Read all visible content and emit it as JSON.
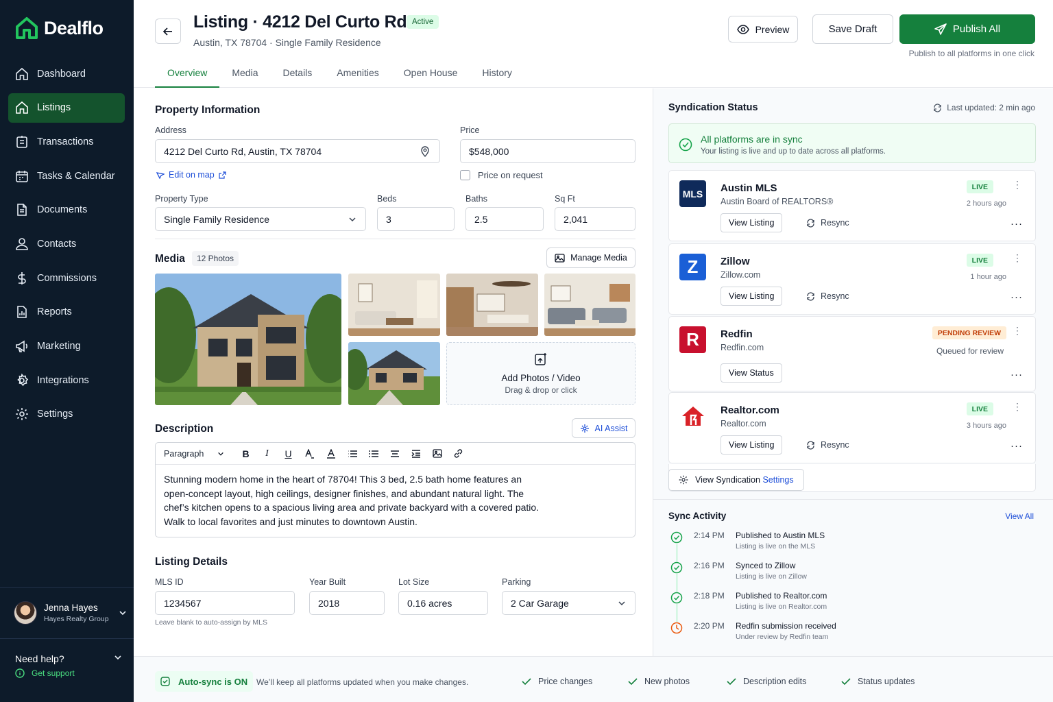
{
  "brand": {
    "name": "Dealflo",
    "accent": "#15803d",
    "sidebar_bg": "#0d1b2a"
  },
  "sidebar": {
    "items": [
      {
        "label": "Dashboard",
        "icon": "home-icon"
      },
      {
        "label": "Listings",
        "icon": "home-icon",
        "active": true
      },
      {
        "label": "Transactions",
        "icon": "document-icon"
      },
      {
        "label": "Tasks & Calendar",
        "icon": "calendar-icon"
      },
      {
        "label": "Documents",
        "icon": "file-icon"
      },
      {
        "label": "Contacts",
        "icon": "user-icon"
      },
      {
        "label": "Commissions",
        "icon": "dollar-icon"
      },
      {
        "label": "Reports",
        "icon": "report-icon"
      },
      {
        "label": "Marketing",
        "icon": "megaphone-icon"
      },
      {
        "label": "Integrations",
        "icon": "integrations-icon"
      },
      {
        "label": "Settings",
        "icon": "gear-icon"
      }
    ],
    "user": {
      "name": "Jenna Hayes",
      "org": "Hayes Realty Group"
    },
    "help": {
      "title": "Need help?",
      "link": "Get support"
    }
  },
  "header": {
    "title": "Listing · 4212 Del Curto Rd",
    "status": "Active",
    "subtitle": "Austin, TX 78704 · Single Family Residence",
    "preview": "Preview",
    "save": "Save Draft",
    "publish": "Publish All",
    "publish_hint": "Publish to all platforms in one click",
    "tabs": [
      "Overview",
      "Media",
      "Details",
      "Amenities",
      "Open House",
      "History"
    ]
  },
  "property": {
    "title": "Property Information",
    "address_label": "Address",
    "address": "4212 Del Curto Rd, Austin, TX 78704",
    "edit_map": "Edit on map",
    "price_label": "Price",
    "price": "$548,000",
    "price_on_request": "Price on request",
    "type_label": "Property Type",
    "type": "Single Family Residence",
    "beds_label": "Beds",
    "beds": "3",
    "baths_label": "Baths",
    "baths": "2.5",
    "sqft_label": "Sq Ft",
    "sqft": "2,041"
  },
  "media": {
    "title": "Media",
    "count": "12 Photos",
    "manage": "Manage Media",
    "add_title": "Add Photos / Video",
    "add_sub": "Drag & drop or click"
  },
  "description": {
    "title": "Description",
    "ai": "AI Assist",
    "format": "Paragraph",
    "lines": [
      "Stunning modern home in the heart of 78704! This 3 bed, 2.5 bath home features an",
      "open-concept layout, high ceilings, designer finishes, and abundant natural light. The",
      "chef’s kitchen opens to a spacious living area and private backyard with a covered patio.",
      "Walk to local favorites and just minutes to downtown Austin."
    ]
  },
  "details": {
    "title": "Listing Details",
    "mls_label": "MLS ID",
    "mls": "1234567",
    "mls_hint": "Leave blank to auto-assign by MLS",
    "year_label": "Year Built",
    "year": "2018",
    "lot_label": "Lot Size",
    "lot": "0.16 acres",
    "parking_label": "Parking",
    "parking": "2 Car Garage"
  },
  "syndication": {
    "title": "Syndication Status",
    "updated": "Last updated: 2 min ago",
    "sync_title": "All platforms are in sync",
    "sync_sub": "Your listing is live and up to date across all platforms.",
    "platforms": [
      {
        "name": "Austin MLS",
        "sub": "Austin Board of REALTORS®",
        "status": "LIVE",
        "time": "2 hours ago",
        "button": "View Listing",
        "resync": "Resync",
        "logo": "MLS",
        "color": "#0f2a5a"
      },
      {
        "name": "Zillow",
        "sub": "Zillow.com",
        "status": "LIVE",
        "time": "1 hour ago",
        "button": "View Listing",
        "resync": "Resync",
        "logo": "Z",
        "color": "#1a5fd6"
      },
      {
        "name": "Redfin",
        "sub": "Redfin.com",
        "status": "PENDING REVIEW",
        "time": "Queued for review",
        "button": "View Status",
        "logo": "R",
        "color": "#c8102e"
      },
      {
        "name": "Realtor.com",
        "sub": "Realtor.com",
        "status": "LIVE",
        "time": "3 hours ago",
        "button": "View Listing",
        "resync": "Resync",
        "logo": "house",
        "color": "#d92228"
      }
    ],
    "settings_prefix": "View Syndication ",
    "settings_link": "Settings"
  },
  "activity": {
    "title": "Sync Activity",
    "view_all": "View All",
    "items": [
      {
        "time": "2:14 PM",
        "title": "Published to Austin MLS",
        "sub": "Listing is live on the MLS",
        "state": "done"
      },
      {
        "time": "2:16 PM",
        "title": "Synced to Zillow",
        "sub": "Listing is live on Zillow",
        "state": "done"
      },
      {
        "time": "2:18 PM",
        "title": "Published to Realtor.com",
        "sub": "Listing is live on Realtor.com",
        "state": "done"
      },
      {
        "time": "2:20 PM",
        "title": "Redfin submission received",
        "sub": "Under review by Redfin team",
        "state": "pending"
      }
    ]
  },
  "footer": {
    "autosync": "Auto-sync is ON",
    "note": "We’ll keep all platforms updated when you make changes.",
    "items": [
      "Price changes",
      "New photos",
      "Description edits",
      "Status updates"
    ]
  }
}
